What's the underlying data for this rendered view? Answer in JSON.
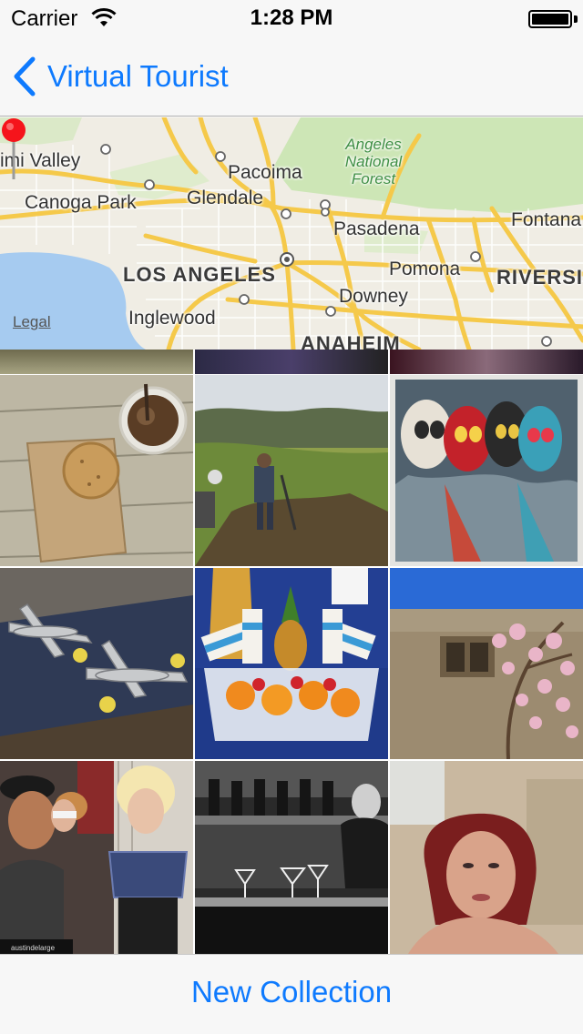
{
  "status_bar": {
    "carrier": "Carrier",
    "time": "1:28 PM"
  },
  "nav": {
    "back_label": "Virtual Tourist"
  },
  "map": {
    "labels": {
      "simi_valley": "imi Valley",
      "canoga_park": "Canoga Park",
      "pacoima": "Pacoima",
      "glendale": "Glendale",
      "angeles_forest": "Angeles National Forest",
      "pasadena": "Pasadena",
      "fontana": "Fontana",
      "los_angeles": "LOS ANGELES",
      "pomona": "Pomona",
      "riverside": "RIVERSI",
      "downey": "Downey",
      "inglewood": "Inglewood",
      "anaheim": "ANAHEIM"
    },
    "legal": "Legal",
    "colors": {
      "land": "#f0ede4",
      "water": "#a6cbf0",
      "park": "#cde6b6",
      "freeway": "#f5c94a",
      "street": "#ffffff"
    }
  },
  "photos": [
    {
      "name": "photo-coffee-cookie",
      "desc": "iced coffee and cookie on table"
    },
    {
      "name": "photo-hillside-workers",
      "desc": "people digging on green hillside"
    },
    {
      "name": "photo-lucha-masks",
      "desc": "colorful wrestling masks polaroid"
    },
    {
      "name": "photo-p38-planes",
      "desc": "model p-38 airplanes"
    },
    {
      "name": "photo-zico-fruit",
      "desc": "zico drinks and fruit display"
    },
    {
      "name": "photo-magnolia-building",
      "desc": "magnolia tree and adobe building"
    },
    {
      "name": "photo-party-selfie",
      "desc": "group of friends posing"
    },
    {
      "name": "photo-bartender",
      "desc": "black and white bartender"
    },
    {
      "name": "photo-woman-selfie",
      "desc": "woman selfie"
    }
  ],
  "photo_caption": "austindelarge",
  "toolbar": {
    "new_collection_label": "New Collection"
  }
}
